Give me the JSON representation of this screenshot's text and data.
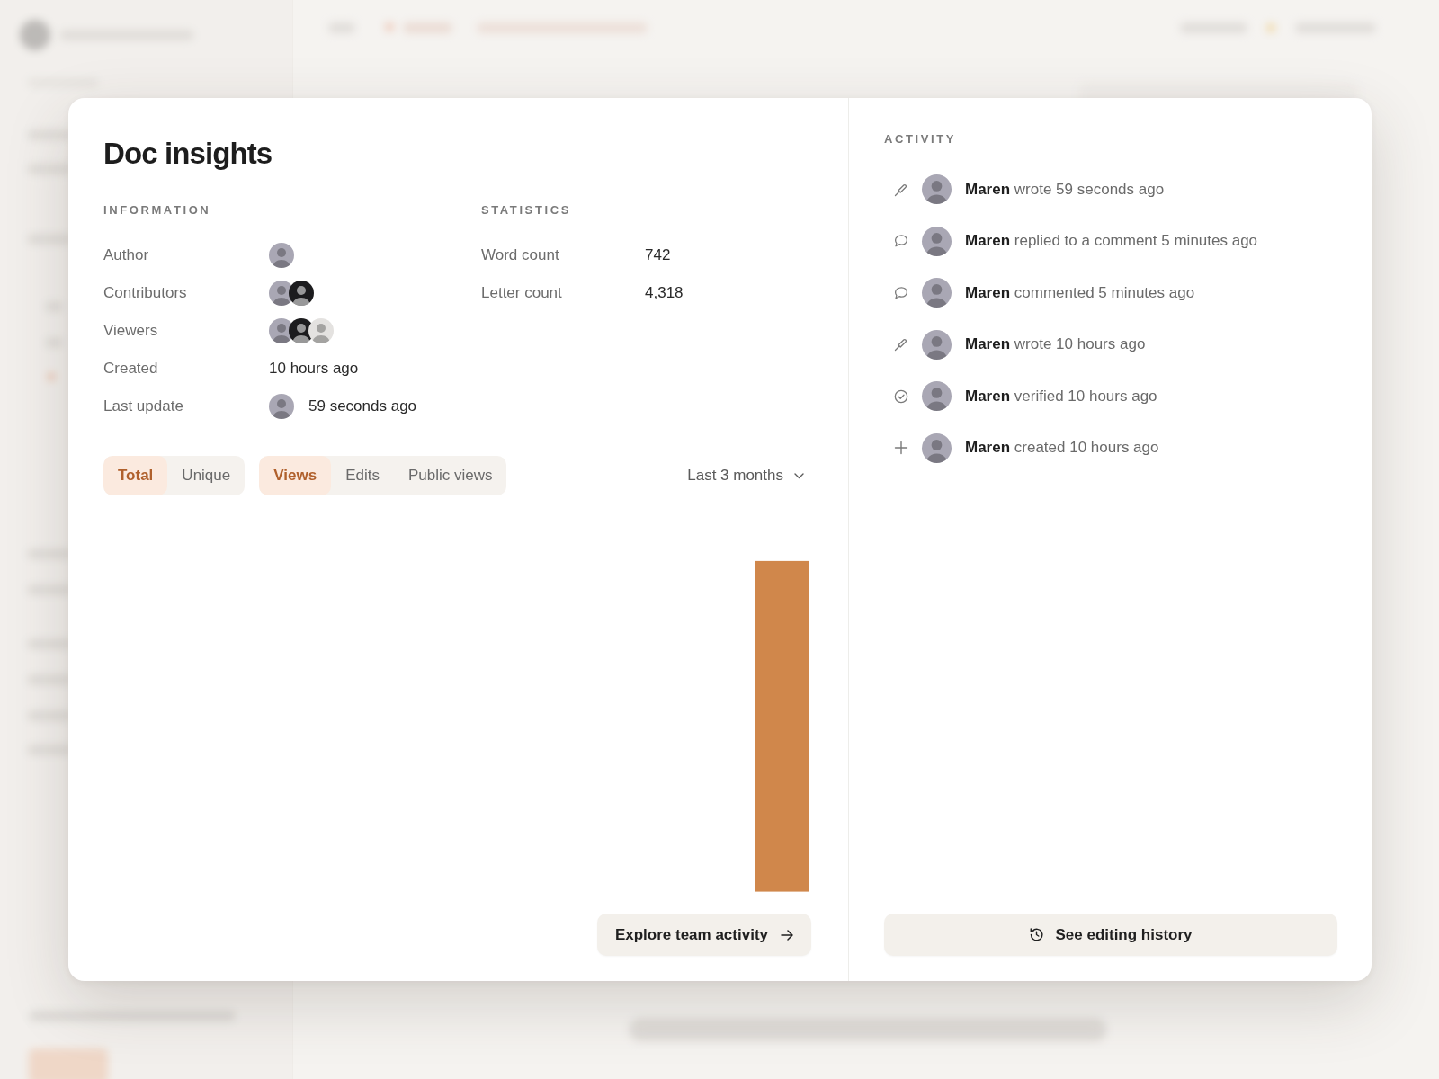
{
  "dialog": {
    "title": "Doc insights"
  },
  "information": {
    "heading": "INFORMATION",
    "rows": [
      {
        "kind": "avatars",
        "label": "Author",
        "avatars": [
          {
            "color": "#a9a7b4"
          }
        ]
      },
      {
        "kind": "avatars",
        "label": "Contributors",
        "avatars": [
          {
            "color": "#a9a7b4"
          },
          {
            "color": "#1c1c1e"
          }
        ]
      },
      {
        "kind": "avatars",
        "label": "Viewers",
        "avatars": [
          {
            "color": "#a9a7b4"
          },
          {
            "color": "#1c1c1e"
          },
          {
            "color": "#e4e2e0"
          }
        ]
      },
      {
        "kind": "text",
        "label": "Created",
        "value": "10 hours ago"
      },
      {
        "kind": "avatar_text",
        "label": "Last update",
        "avatars": [
          {
            "color": "#a9a7b4"
          }
        ],
        "value": "59 seconds ago"
      }
    ]
  },
  "statistics": {
    "heading": "STATISTICS",
    "rows": [
      {
        "label": "Word count",
        "value": "742"
      },
      {
        "label": "Letter count",
        "value": "4,318"
      }
    ]
  },
  "count_toggle": [
    {
      "label": "Total",
      "selected": true
    },
    {
      "label": "Unique",
      "selected": false
    }
  ],
  "event_toggle": [
    {
      "label": "Views",
      "selected": true
    },
    {
      "label": "Edits",
      "selected": false
    },
    {
      "label": "Public views",
      "selected": false
    }
  ],
  "range_dropdown": {
    "value": "Last 3 months"
  },
  "explore_button": {
    "label": "Explore team activity"
  },
  "activity": {
    "heading": "ACTIVITY",
    "items": [
      {
        "kind": "write",
        "text": "**Maren** wrote 59 seconds ago"
      },
      {
        "kind": "comment",
        "text": "**Maren** replied to a comment 5 minutes ago"
      },
      {
        "kind": "comment",
        "text": "**Maren** commented 5 minutes ago"
      },
      {
        "kind": "write",
        "text": "**Maren** wrote 10 hours ago"
      },
      {
        "kind": "verify",
        "text": "**Maren** verified 10 hours ago"
      },
      {
        "kind": "create",
        "text": "**Maren** created 10 hours ago"
      }
    ]
  },
  "history_button": {
    "label": "See editing history"
  }
}
